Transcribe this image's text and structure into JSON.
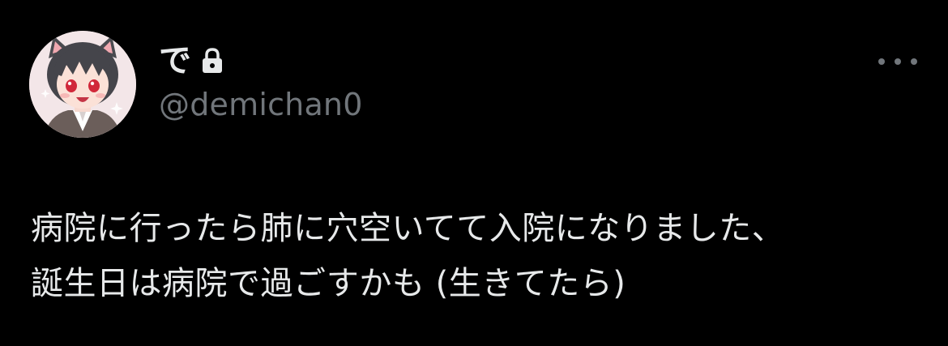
{
  "user": {
    "display_name": "で",
    "handle": "@demichan0",
    "protected_icon": "lock-icon",
    "avatar": "anime-character-avatar"
  },
  "tweet": {
    "lines": [
      "病院に行ったら肺に穴空いてて入院になりました、",
      "誕生日は病院で過ごすかも (生きてたら)"
    ]
  },
  "actions": {
    "more_icon": "more-options-icon"
  },
  "colors": {
    "background": "#000000",
    "primary_text": "#e7e9ea",
    "secondary_text": "#71767b"
  }
}
